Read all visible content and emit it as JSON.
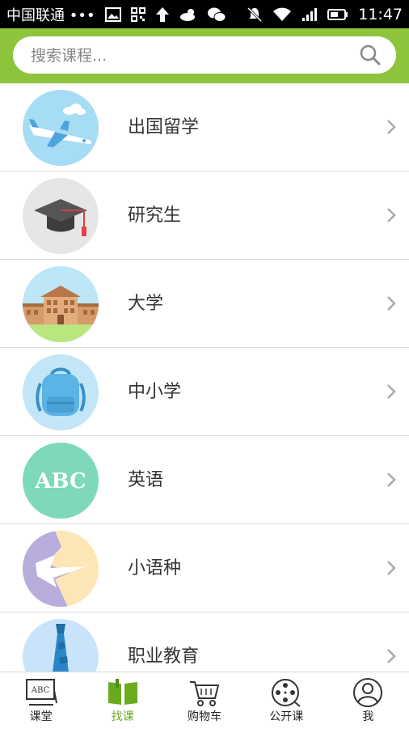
{
  "status_bar": {
    "carrier": "中国联通 •••",
    "time": "11:47"
  },
  "search": {
    "placeholder": "搜索课程..."
  },
  "categories": [
    {
      "label": "出国留学",
      "icon": "airplane-icon",
      "color": "#a7dcf5"
    },
    {
      "label": "研究生",
      "icon": "graduation-cap-icon",
      "color": "#e6e6e6"
    },
    {
      "label": "大学",
      "icon": "university-building-icon",
      "color": "#bde7f7"
    },
    {
      "label": "中小学",
      "icon": "backpack-icon",
      "color": "#c2e6f7"
    },
    {
      "label": "英语",
      "icon": "abc-icon",
      "color": "#7dd9b9",
      "text": "ABC"
    },
    {
      "label": "小语种",
      "icon": "language-icon",
      "color": "#fde6b5"
    },
    {
      "label": "职业教育",
      "icon": "tie-icon",
      "color": "#c9e4fa"
    }
  ],
  "tabs": [
    {
      "label": "课堂",
      "icon": "blackboard-abc-icon",
      "active": false,
      "icon_text": "ABC"
    },
    {
      "label": "找课",
      "icon": "book-icon",
      "active": true
    },
    {
      "label": "购物车",
      "icon": "cart-icon",
      "active": false
    },
    {
      "label": "公开课",
      "icon": "film-reel-icon",
      "active": false
    },
    {
      "label": "我",
      "icon": "profile-icon",
      "active": false
    }
  ],
  "colors": {
    "brand_green": "#8dc43c",
    "active_tab": "#6aaa1e"
  }
}
